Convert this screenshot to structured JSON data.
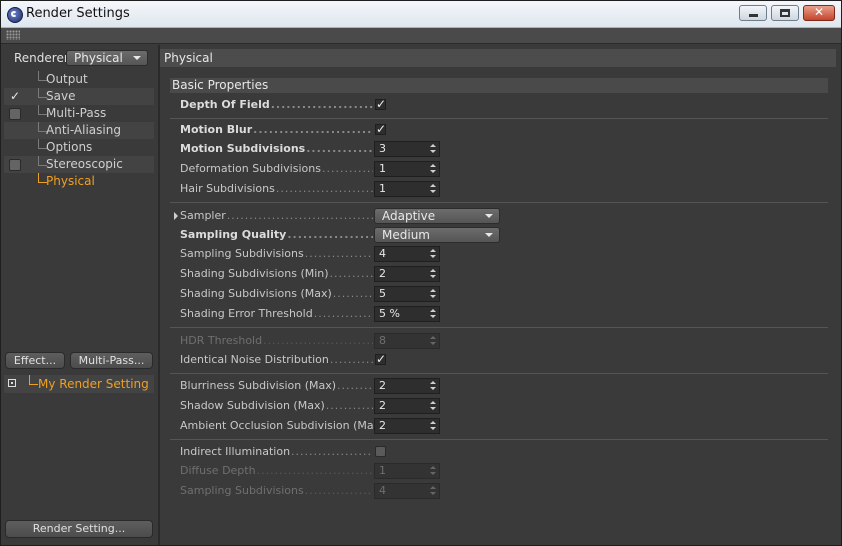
{
  "window": {
    "title": "Render Settings"
  },
  "left": {
    "renderer_label": "Renderer",
    "renderer_value": "Physical",
    "nav": [
      {
        "label": "Output",
        "marker": "none"
      },
      {
        "label": "Save",
        "marker": "check"
      },
      {
        "label": "Multi-Pass",
        "marker": "box"
      },
      {
        "label": "Anti-Aliasing",
        "marker": "none"
      },
      {
        "label": "Options",
        "marker": "none"
      },
      {
        "label": "Stereoscopic",
        "marker": "box"
      },
      {
        "label": "Physical",
        "marker": "none",
        "selected": true
      }
    ],
    "check_glyph": "✓",
    "effect_button": "Effect...",
    "multipass_button": "Multi-Pass...",
    "render_setting_name": "My Render Setting",
    "render_setting_button": "Render Setting..."
  },
  "right": {
    "panel_title": "Physical",
    "section_title": "Basic Properties",
    "check_glyph": "✓",
    "rows": {
      "depth_of_field": {
        "label": "Depth Of Field",
        "checked": true
      },
      "motion_blur": {
        "label": "Motion Blur",
        "checked": true
      },
      "motion_subdivisions": {
        "label": "Motion Subdivisions",
        "value": "3"
      },
      "deformation_subdivisions": {
        "label": "Deformation Subdivisions",
        "value": "1"
      },
      "hair_subdivisions": {
        "label": "Hair Subdivisions",
        "value": "1"
      },
      "sampler": {
        "label": "Sampler",
        "value": "Adaptive"
      },
      "sampling_quality": {
        "label": "Sampling Quality",
        "value": "Medium"
      },
      "sampling_subdivisions": {
        "label": "Sampling Subdivisions",
        "value": "4"
      },
      "shading_subdivisions_min": {
        "label": "Shading Subdivisions (Min)",
        "value": "2"
      },
      "shading_subdivisions_max": {
        "label": "Shading Subdivisions (Max)",
        "value": "5"
      },
      "shading_error_threshold": {
        "label": "Shading Error Threshold",
        "value": "5 %"
      },
      "hdr_threshold": {
        "label": "HDR Threshold",
        "value": "8"
      },
      "identical_noise": {
        "label": "Identical Noise Distribution",
        "checked": true
      },
      "blurriness_subdivision": {
        "label": "Blurriness Subdivision (Max)",
        "value": "2"
      },
      "shadow_subdivision": {
        "label": "Shadow Subdivision (Max)",
        "value": "2"
      },
      "ao_subdivision": {
        "label": "Ambient Occlusion Subdivision (Max)",
        "value": "2"
      },
      "indirect_illumination": {
        "label": "Indirect Illumination",
        "checked": false
      },
      "diffuse_depth": {
        "label": "Diffuse Depth",
        "value": "1"
      },
      "gi_sampling_subdivisions": {
        "label": "Sampling Subdivisions",
        "value": "4"
      }
    }
  },
  "colors": {
    "accent": "#f0a020",
    "panel": "#3a3a3a"
  }
}
